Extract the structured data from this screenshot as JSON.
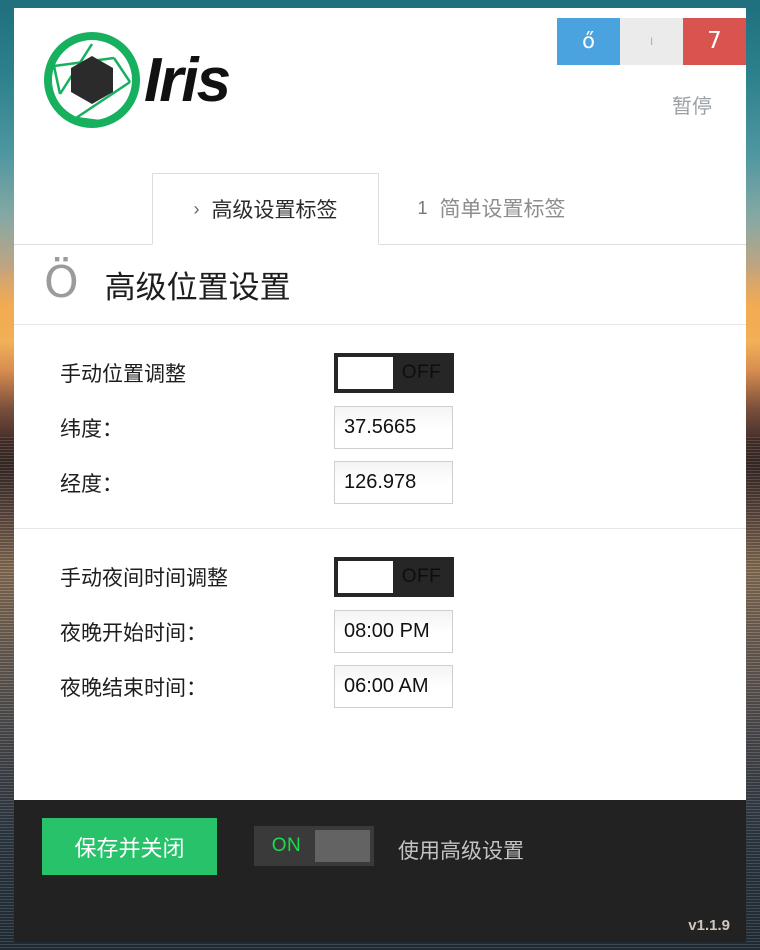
{
  "window": {
    "controls": [
      {
        "name": "settings",
        "glyph": "ő",
        "color": "#4aa3df"
      },
      {
        "name": "minimize",
        "glyph": "ı",
        "color": "#ebebeb"
      },
      {
        "name": "close",
        "glyph": "7",
        "color": "#d9534f"
      }
    ],
    "version": "v1.1.9"
  },
  "header": {
    "logo_text": "Iris",
    "logo_color": "#16b05f",
    "pause_label": "暂停"
  },
  "tabs": [
    {
      "num": "›",
      "label": "高级设置标签",
      "active": true
    },
    {
      "num": "1",
      "label": "简单设置标签",
      "active": false
    }
  ],
  "page": {
    "title_icon": "Ö",
    "title": "高级位置设置"
  },
  "location_section": {
    "manual_toggle": {
      "label": "手动位置调整",
      "state": "OFF",
      "on": false
    },
    "latitude": {
      "label": "纬度：",
      "value": "37.5665"
    },
    "longitude": {
      "label": "经度：",
      "value": "126.978"
    }
  },
  "night_section": {
    "manual_toggle": {
      "label": "手动夜间时间调整",
      "state": "OFF",
      "on": false
    },
    "night_start": {
      "label": "夜晚开始时间：",
      "value": "08:00 PM"
    },
    "night_end": {
      "label": "夜晚结束时间：",
      "value": "06:00 AM"
    }
  },
  "footer": {
    "save_label": "保存并关闭",
    "save_color": "#27c26a",
    "advanced_toggle": {
      "state": "ON",
      "label": "使用高级设置",
      "on": true,
      "on_color": "#19dd4a"
    }
  }
}
